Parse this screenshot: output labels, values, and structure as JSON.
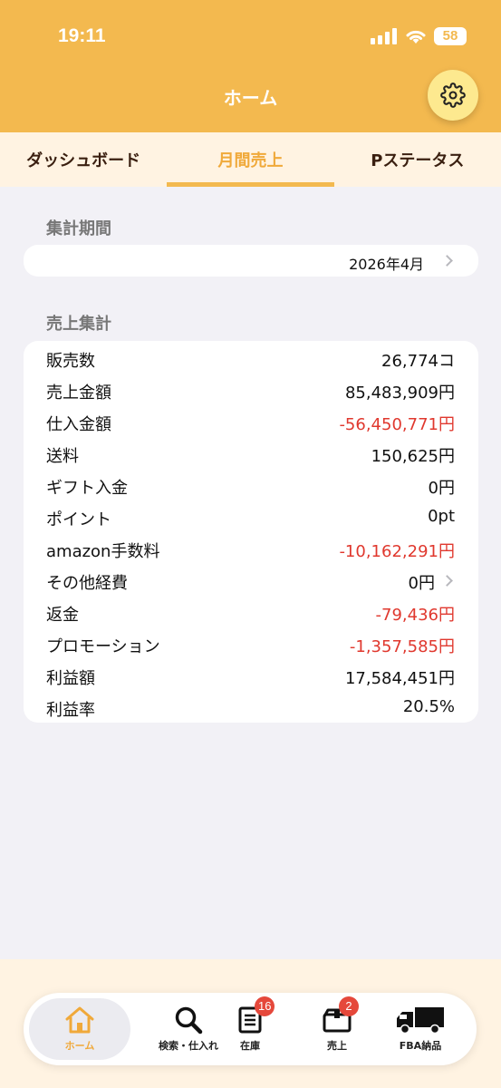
{
  "status_bar": {
    "time": "19:11",
    "battery": "58"
  },
  "header": {
    "title": "ホーム"
  },
  "tabs": [
    {
      "label": "ダッシュボード",
      "active": false
    },
    {
      "label": "月間売上",
      "active": true
    },
    {
      "label": "Pステータス",
      "active": false
    }
  ],
  "period": {
    "section_label": "集計期間",
    "value": "2026年4月"
  },
  "summary": {
    "section_label": "売上集計",
    "rows": [
      {
        "label": "販売数",
        "value": "26,774コ",
        "negative": false
      },
      {
        "label": "売上金額",
        "value": "85,483,909円",
        "negative": false
      },
      {
        "label": "仕入金額",
        "value": "-56,450,771円",
        "negative": true
      },
      {
        "label": "送料",
        "value": "150,625円",
        "negative": false
      },
      {
        "label": "ギフト入金",
        "value": "0円",
        "negative": false
      },
      {
        "label": "ポイント",
        "value": "0pt",
        "negative": false
      },
      {
        "label": "amazon手数料",
        "value": "-10,162,291円",
        "negative": true
      },
      {
        "label": "その他経費",
        "value": "0円",
        "negative": false,
        "chevron": true
      },
      {
        "label": "返金",
        "value": "-79,436円",
        "negative": true
      },
      {
        "label": "プロモーション",
        "value": "-1,357,585円",
        "negative": true
      },
      {
        "label": "利益額",
        "value": "17,584,451円",
        "negative": false
      },
      {
        "label": "利益率",
        "value": "20.5%",
        "negative": false
      }
    ]
  },
  "tabbar": [
    {
      "label": "ホーム",
      "icon": "home-icon",
      "active": true
    },
    {
      "label": "検索・仕入れ",
      "icon": "search-icon",
      "active": false
    },
    {
      "label": "在庫",
      "icon": "inventory-icon",
      "active": false,
      "badge": "16"
    },
    {
      "label": "売上",
      "icon": "sales-box-icon",
      "active": false,
      "badge": "2"
    },
    {
      "label": "FBA納品",
      "icon": "truck-icon",
      "active": false
    }
  ],
  "colors": {
    "header": "#f3b94f",
    "accent": "#f0a93a",
    "negative": "#e0382e",
    "tab_bg": "#fff3e2",
    "background": "#f2f1f6"
  }
}
